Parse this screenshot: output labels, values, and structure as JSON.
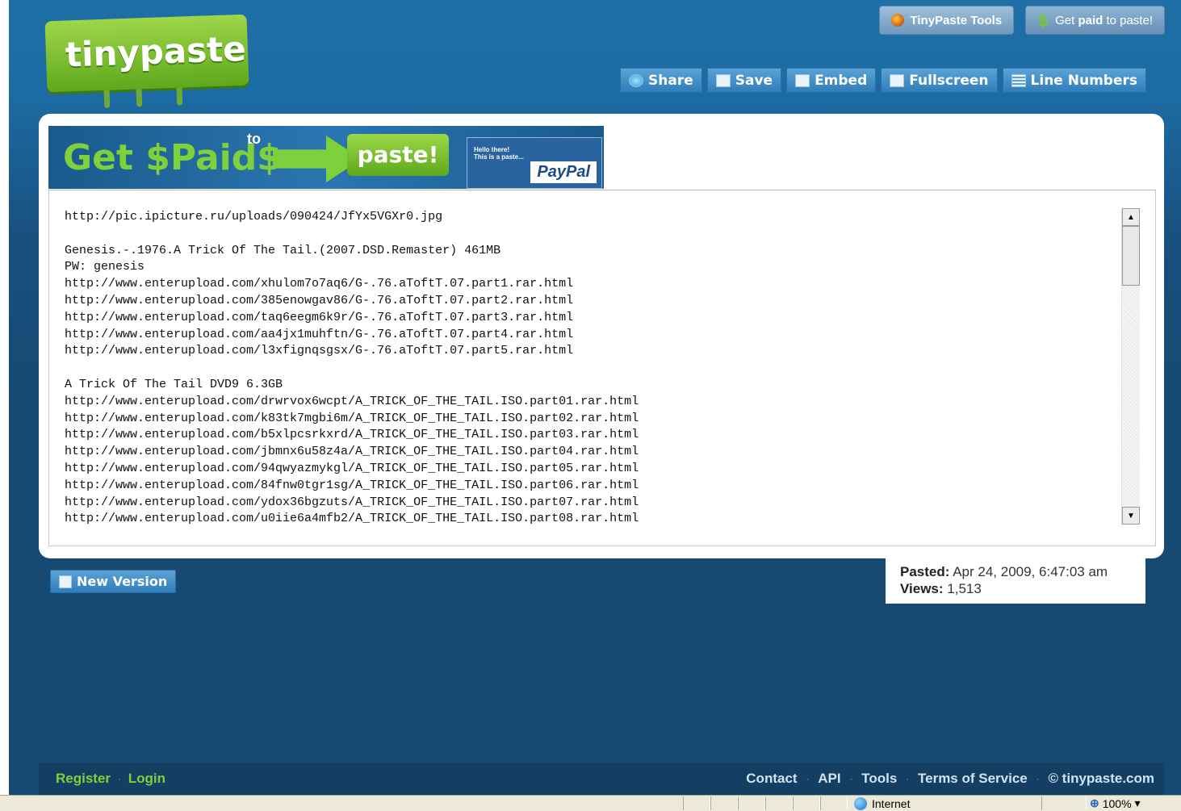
{
  "top_tools": {
    "tinypaste_tools": "TinyPaste Tools",
    "get_paid_pre": "Get ",
    "get_paid_bold": "paid",
    "get_paid_post": " to paste!"
  },
  "logo": "tinypaste",
  "actions": {
    "share": "Share",
    "save": "Save",
    "embed": "Embed",
    "fullscreen": "Fullscreen",
    "line_numbers": "Line Numbers"
  },
  "banner": {
    "get_paid": "Get $Paid$",
    "to": "to",
    "paste": "paste!",
    "hello": "Hello there!\nThis is a paste...",
    "paypal": "PayPal"
  },
  "paste_lines": [
    "http://pic.ipicture.ru/uploads/090424/JfYx5VGXr0.jpg",
    "",
    "Genesis.-.1976.A Trick Of The Tail.(2007.DSD.Remaster) 461MB",
    "PW: genesis",
    "http://www.enterupload.com/xhulom7o7aq6/G-.76.aToftT.07.part1.rar.html",
    "http://www.enterupload.com/385enowgav86/G-.76.aToftT.07.part2.rar.html",
    "http://www.enterupload.com/taq6eegm6k9r/G-.76.aToftT.07.part3.rar.html",
    "http://www.enterupload.com/aa4jx1muhftn/G-.76.aToftT.07.part4.rar.html",
    "http://www.enterupload.com/l3xfignqsgsx/G-.76.aToftT.07.part5.rar.html",
    "",
    "A Trick Of The Tail DVD9 6.3GB",
    "http://www.enterupload.com/drwrvox6wcpt/A_TRICK_OF_THE_TAIL.ISO.part01.rar.html",
    "http://www.enterupload.com/k83tk7mgbi6m/A_TRICK_OF_THE_TAIL.ISO.part02.rar.html",
    "http://www.enterupload.com/b5xlpcsrkxrd/A_TRICK_OF_THE_TAIL.ISO.part03.rar.html",
    "http://www.enterupload.com/jbmnx6u58z4a/A_TRICK_OF_THE_TAIL.ISO.part04.rar.html",
    "http://www.enterupload.com/94qwyazmykgl/A_TRICK_OF_THE_TAIL.ISO.part05.rar.html",
    "http://www.enterupload.com/84fnw0tgr1sg/A_TRICK_OF_THE_TAIL.ISO.part06.rar.html",
    "http://www.enterupload.com/ydox36bgzuts/A_TRICK_OF_THE_TAIL.ISO.part07.rar.html",
    "http://www.enterupload.com/u0iie6a4mfb2/A_TRICK_OF_THE_TAIL.ISO.part08.rar.html"
  ],
  "new_version": "New Version",
  "meta": {
    "pasted_label": "Pasted:",
    "pasted_value": "Apr 24, 2009, 6:47:03 am",
    "views_label": "Views:",
    "views_value": "1,513"
  },
  "footer": {
    "register": "Register",
    "login": "Login",
    "contact": "Contact",
    "api": "API",
    "tools": "Tools",
    "tos": "Terms of Service",
    "copyright": "© tinypaste.com",
    "sep": "·"
  },
  "statusbar": {
    "zone": "Internet",
    "zoom": "100%"
  },
  "colors": {
    "brand_green": "#7fd13b",
    "page_blue": "#1c6ba3",
    "button_blue": "#2f7dba"
  }
}
